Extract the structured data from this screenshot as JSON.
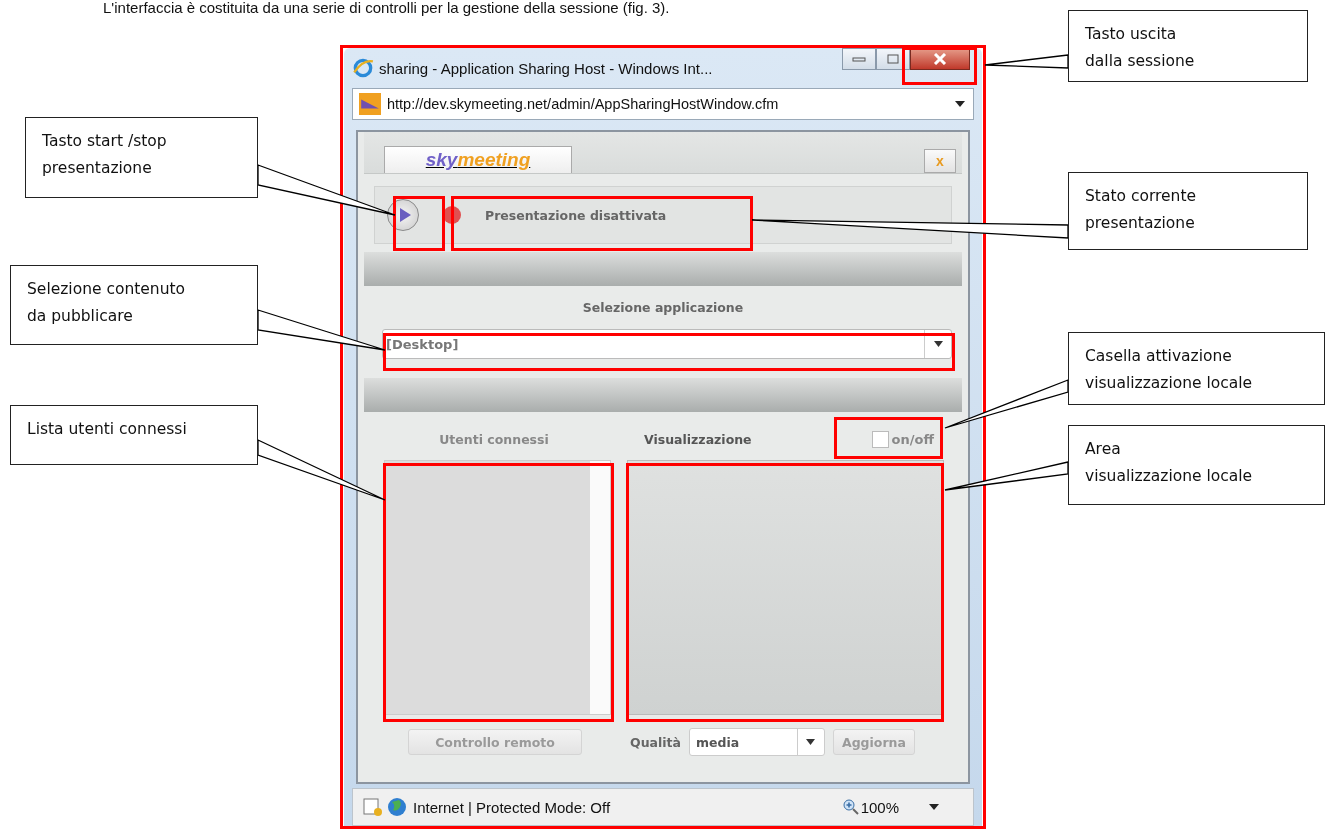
{
  "intro": "L'interfaccia è costituita da una serie di controlli per la gestione della sessione (fig. 3).",
  "window": {
    "title": "sharing - Application Sharing Host - Windows Int...",
    "address": "http://dev.skymeeting.net/admin/AppSharingHostWindow.cfm"
  },
  "app": {
    "logo": {
      "first": "sky",
      "second": "meeting"
    },
    "close_label": "x",
    "presenting": false,
    "status_text": "Presentazione disattivata",
    "selection_label": "Selezione applicazione",
    "application": "[Desktop]",
    "users_label": "Utenti connessi",
    "view_label": "Visualizzazione",
    "local_view": {
      "label": "on/off",
      "checked": false
    },
    "remote_button": {
      "label": "Controllo remoto",
      "disabled": true
    },
    "quality_label": "Qualità",
    "quality": "media",
    "refresh_button": {
      "label": "Aggiorna",
      "disabled": true
    }
  },
  "status_bar": {
    "zone": "Internet | Protected Mode: Off",
    "zoom": "100%"
  },
  "callouts": [
    {
      "lines": [
        "Tasto start /stop",
        "presentazione"
      ]
    },
    {
      "lines": [
        "Selezione contenuto",
        "da pubblicare"
      ]
    },
    {
      "lines": [
        "Lista utenti connessi"
      ]
    },
    {
      "lines": [
        "Tasto uscita",
        "dalla sessione"
      ]
    },
    {
      "lines": [
        "Stato corrente",
        "presentazione"
      ]
    },
    {
      "lines": [
        "Casella attivazione",
        "visualizzazione locale"
      ]
    },
    {
      "lines": [
        "Area",
        "visualizzazione locale"
      ]
    }
  ]
}
